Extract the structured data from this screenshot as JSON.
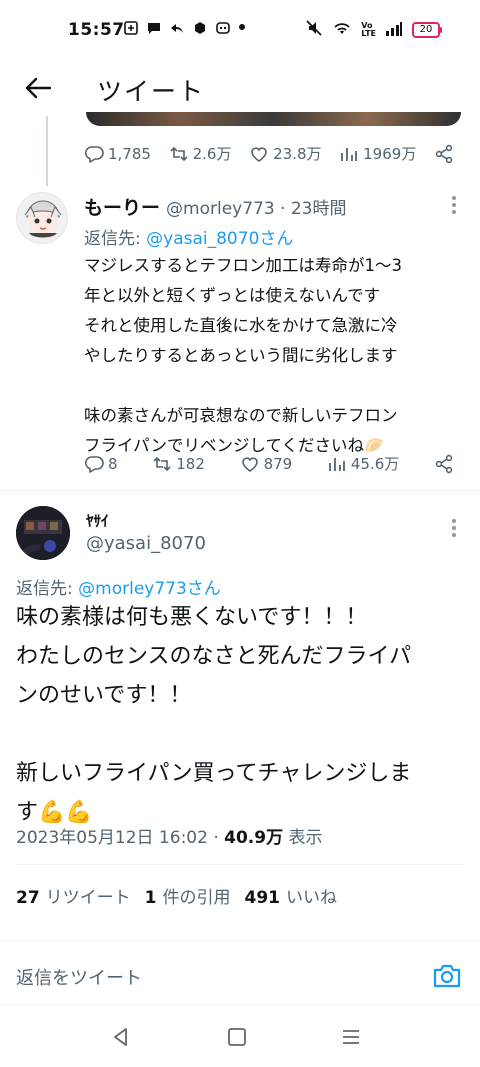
{
  "status_bar": {
    "time": "15:57",
    "battery": "20"
  },
  "header": {
    "title": "ツイート"
  },
  "prev_tweet": {
    "replies": "1,785",
    "retweets": "2.6万",
    "likes": "23.8万",
    "views": "1969万"
  },
  "reply_tweet": {
    "display_name": "もーりー",
    "handle_time": "@morley773 · 23時間",
    "reply_prefix": "返信先: ",
    "reply_target": "@yasai_8070さん",
    "text": "マジレスするとテフロン加工は寿命が1〜3\n年と以外と短くずっとは使えないんです\nそれと使用した直後に水をかけて急激に冷\nやしたりするとあっという間に劣化します\n\n味の素さんが可哀想なので新しいテフロン\nフライパンでリベンジしてくださいね🥟",
    "replies": "8",
    "retweets": "182",
    "likes": "879",
    "views": "45.6万"
  },
  "main_tweet": {
    "display_name": "ﾔｻｲ",
    "handle": "@yasai_8070",
    "reply_prefix": "返信先: ",
    "reply_target": "@morley773さん",
    "text": "味の素様は何も悪くないです！！！\nわたしのセンスのなさと死んだフライパ\nンのせいです！！\n\n新しいフライパン買ってチャレンジしま\nす💪💪",
    "date": "2023年05月12日 16:02 · ",
    "views_count": "40.9万",
    "views_label": " 表示",
    "stats": {
      "retweets_count": "27",
      "retweets_label": "リツイート",
      "quotes_count": "1",
      "quotes_label": "件の引用",
      "likes_count": "491",
      "likes_label": "いいね"
    }
  },
  "reply_box": {
    "placeholder": "返信をツイート"
  },
  "colors": {
    "accent": "#1d9bf0",
    "text": "#0f1419",
    "secondary": "#536471"
  }
}
